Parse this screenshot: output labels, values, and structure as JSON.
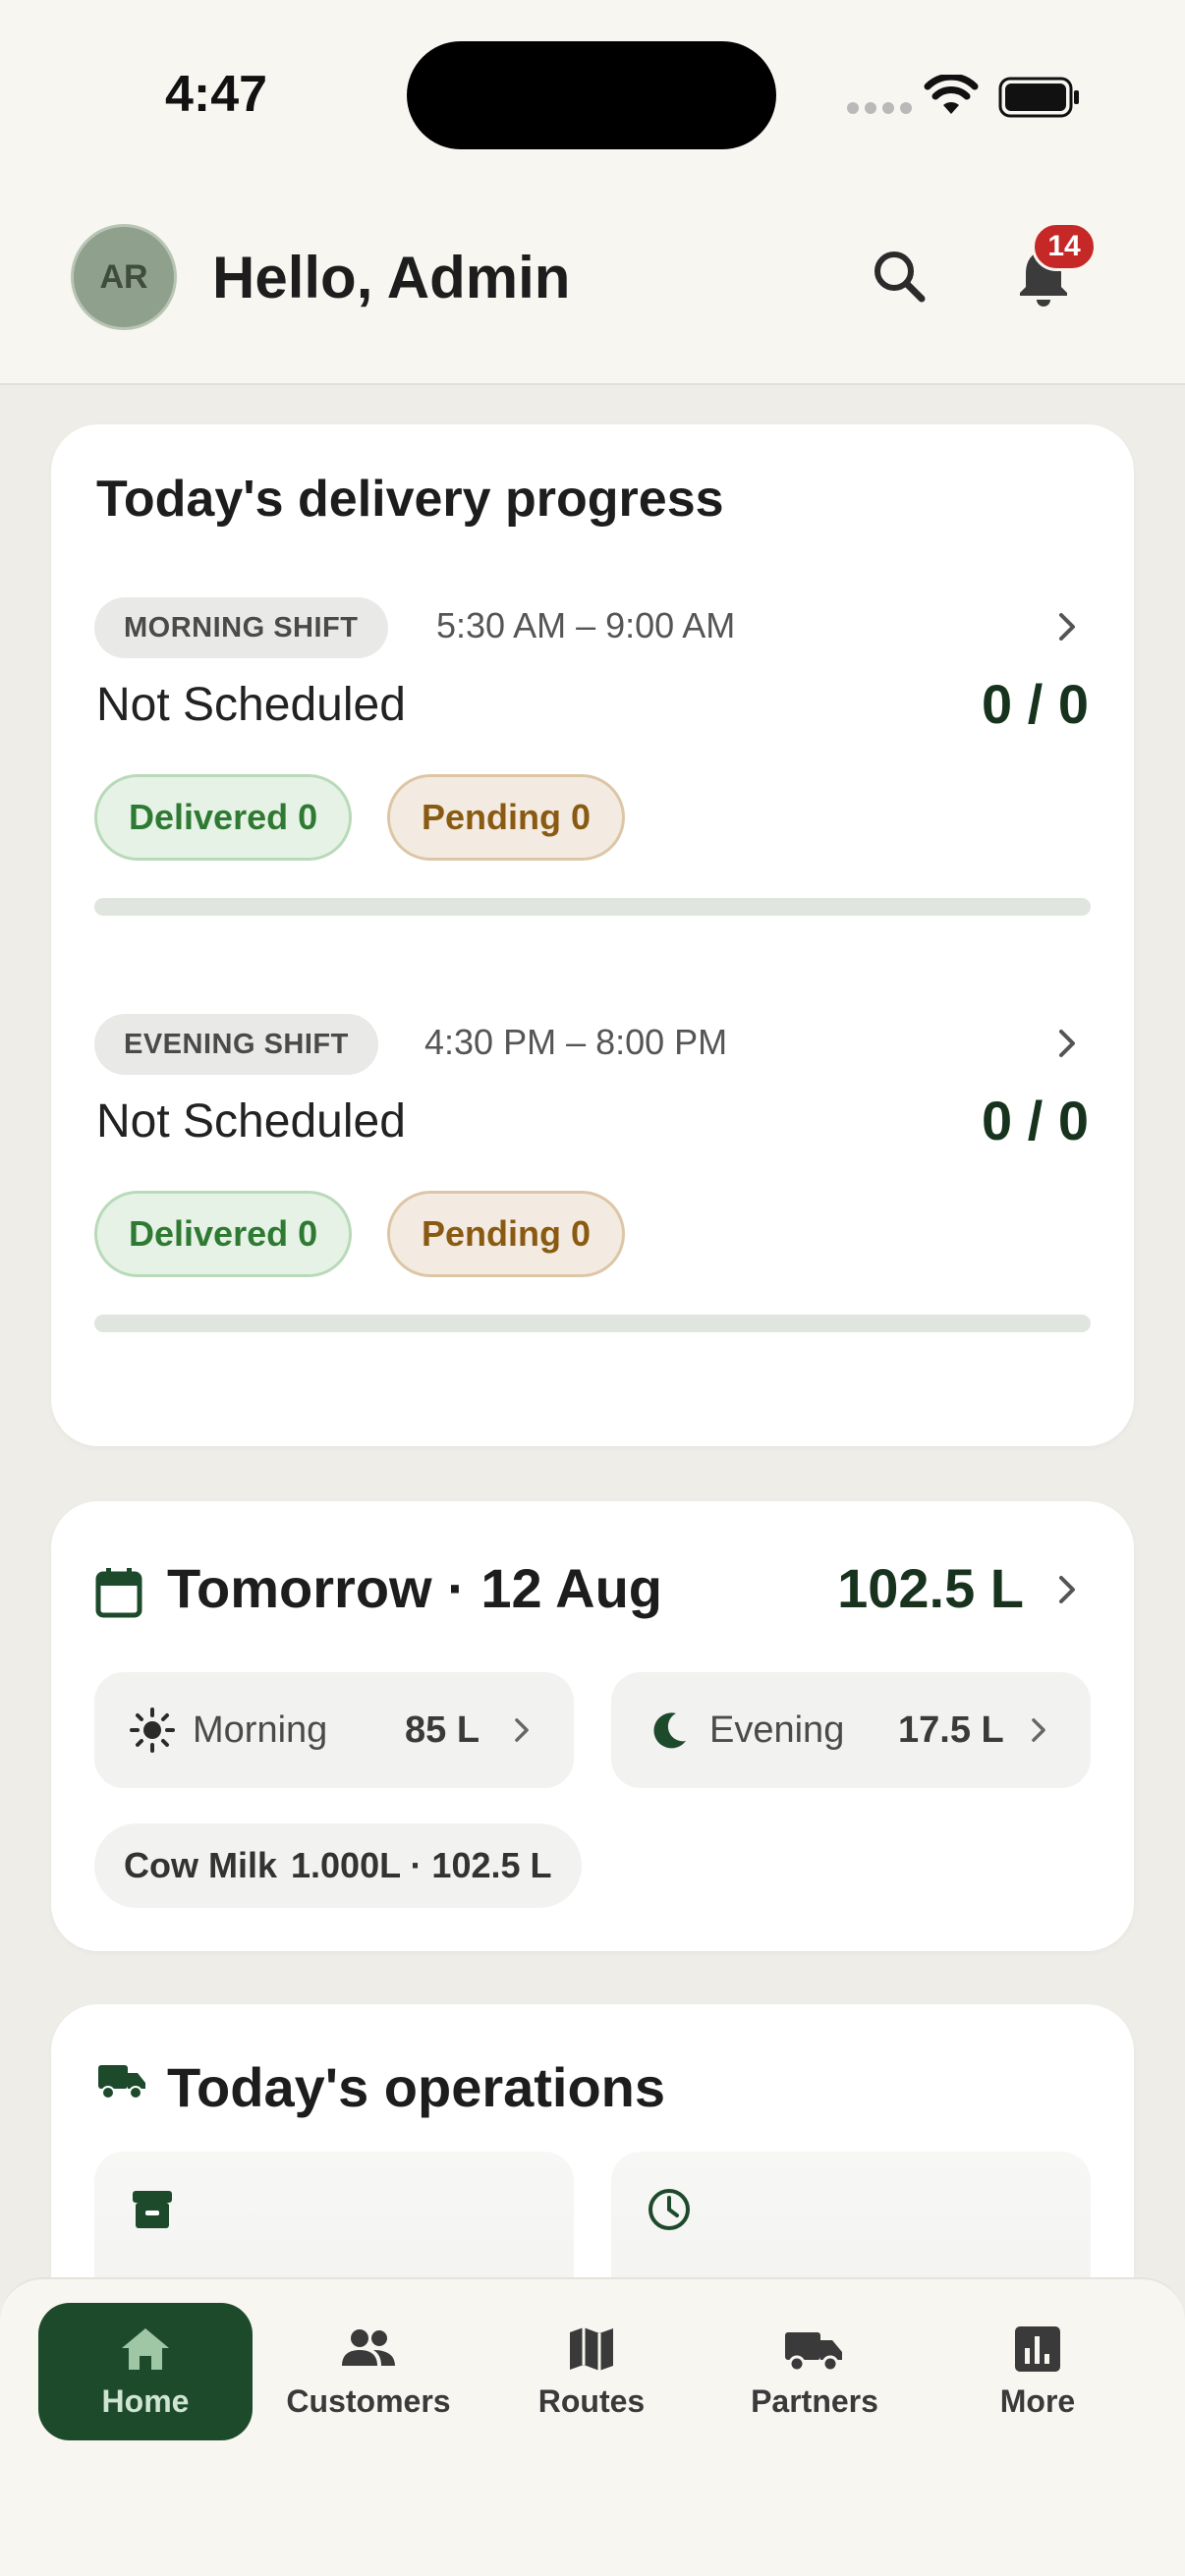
{
  "status_bar": {
    "time": "4:47"
  },
  "header": {
    "avatar_initials": "AR",
    "greeting": "Hello, Admin",
    "notification_count": "14"
  },
  "progress": {
    "title": "Today's delivery progress",
    "shifts": [
      {
        "name": "MORNING SHIFT",
        "time": "5:30 AM – 9:00 AM",
        "status": "Not Scheduled",
        "count": "0 / 0",
        "delivered": "Delivered 0",
        "pending": "Pending 0",
        "progress_fraction": 0
      },
      {
        "name": "EVENING SHIFT",
        "time": "4:30 PM – 8:00 PM",
        "status": "Not Scheduled",
        "count": "0 / 0",
        "delivered": "Delivered 0",
        "pending": "Pending 0",
        "progress_fraction": 0
      }
    ]
  },
  "tomorrow": {
    "title": "Tomorrow · 12 Aug",
    "total": "102.5 L",
    "morning_label": "Morning",
    "morning_value": "85 L",
    "evening_label": "Evening",
    "evening_value": "17.5 L",
    "product_name": "Cow Milk",
    "product_detail": "1.000L · 102.5 L"
  },
  "operations": {
    "title": "Today's operations"
  },
  "nav": {
    "home": "Home",
    "customers": "Customers",
    "routes": "Routes",
    "partners": "Partners",
    "more": "More"
  },
  "colors": {
    "accent": "#1e4a2c",
    "delivered": "#2f7a33",
    "pending": "#8a5a12",
    "badge": "#c62828"
  }
}
